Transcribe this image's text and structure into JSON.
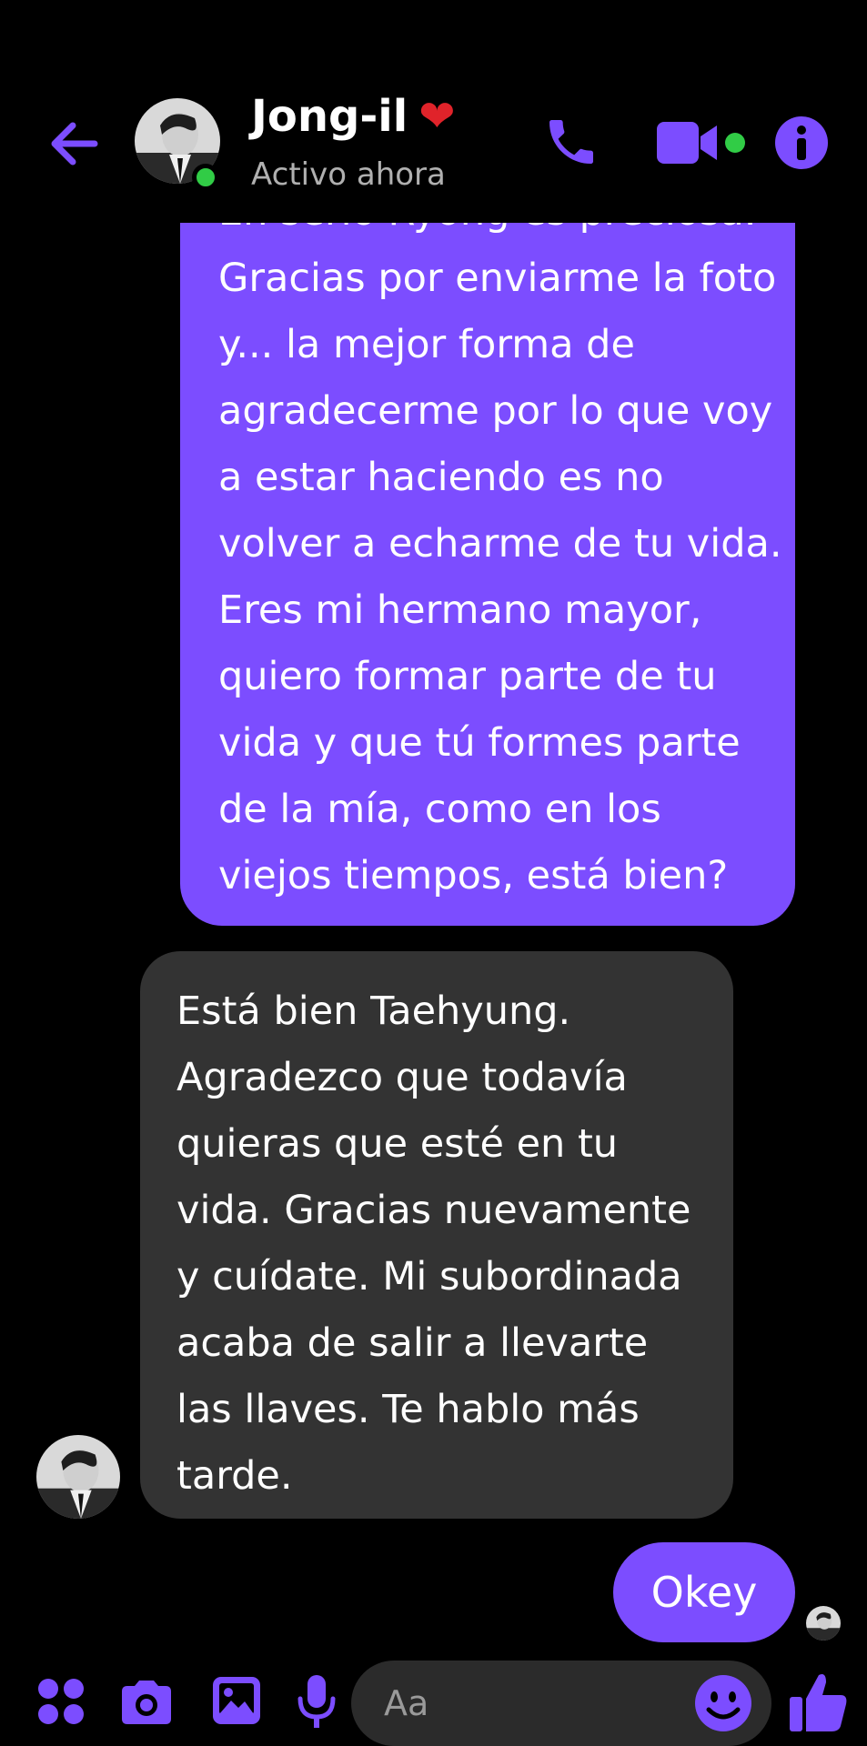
{
  "header": {
    "contact_name": "Jong-il",
    "heart": "❤",
    "status": "Activo ahora"
  },
  "messages": [
    {
      "direction": "outgoing",
      "text": "En serio Ryong es preciosa. Gracias por enviarme la foto y... la mejor forma de agradecerme por lo que voy a estar haciendo es no volver a echarme de tu vida. Eres mi hermano mayor, quiero formar parte de tu vida y que tú formes parte de la mía, como en los viejos tiempos, está bien?"
    },
    {
      "direction": "incoming",
      "text": "Está bien Taehyung. Agradezco que todavía quieras que esté en tu vida. Gracias nuevamente y cuídate. Mi subordinada acaba de salir a llevarte las llaves. Te hablo más tarde."
    },
    {
      "direction": "outgoing",
      "text": "Okey"
    }
  ],
  "composer": {
    "placeholder": "Aa"
  },
  "icons": {
    "back": "back-arrow-icon",
    "phone": "phone-icon",
    "video": "video-icon",
    "info": "info-icon",
    "apps": "apps-icon",
    "camera": "camera-icon",
    "image": "image-icon",
    "mic": "mic-icon",
    "emoji": "emoji-icon",
    "like": "thumbs-up-icon"
  },
  "colors": {
    "accent": "#7c4dff",
    "incoming_bubble": "#333333",
    "online": "#31cc46",
    "background": "#000000"
  }
}
